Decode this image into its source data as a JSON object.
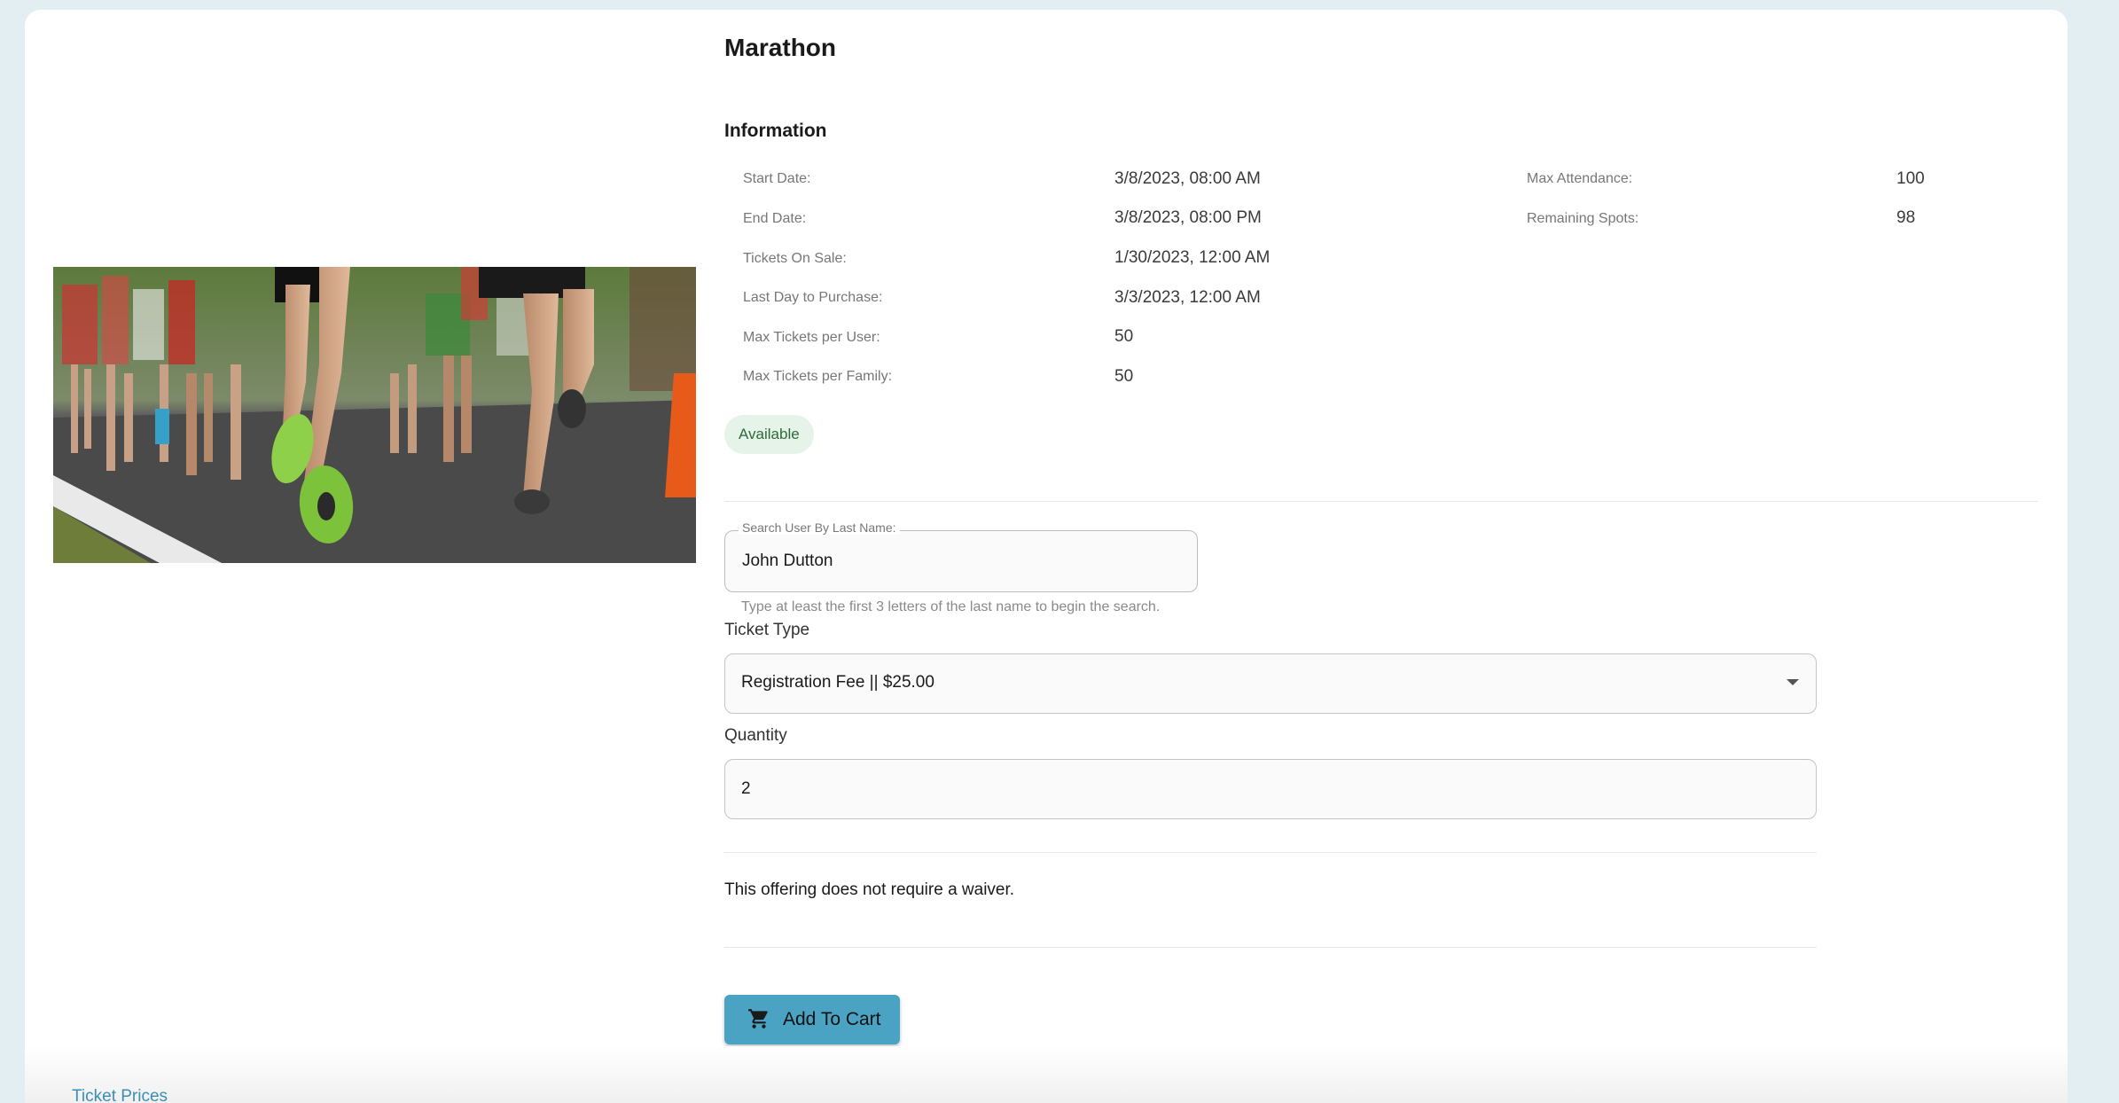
{
  "event": {
    "title": "Marathon",
    "section_title": "Information"
  },
  "info_left": [
    {
      "label": "Start Date:",
      "value": "3/8/2023, 08:00 AM"
    },
    {
      "label": "End Date:",
      "value": "3/8/2023, 08:00 PM"
    },
    {
      "label": "Tickets On Sale:",
      "value": "1/30/2023, 12:00 AM"
    },
    {
      "label": "Last Day to Purchase:",
      "value": "3/3/2023, 12:00 AM"
    },
    {
      "label": "Max Tickets per User:",
      "value": "50"
    },
    {
      "label": "Max Tickets per Family:",
      "value": "50"
    }
  ],
  "info_right": [
    {
      "label": "Max Attendance:",
      "value": "100"
    },
    {
      "label": "Remaining Spots:",
      "value": "98"
    }
  ],
  "status_chip": "Available",
  "search": {
    "label": "Search User By Last Name:",
    "value": "John Dutton",
    "helper": "Type at least the first 3 letters of the last name to begin the search."
  },
  "ticket_type": {
    "caption": "Ticket Type",
    "selected": "Registration Fee || $25.00"
  },
  "quantity": {
    "caption": "Quantity",
    "value": "2"
  },
  "waiver_text": "This offering does not require a waiver.",
  "cart_button": {
    "label": "Add To Cart",
    "icon": "shopping-cart-icon"
  },
  "footer_link": "Ticket Prices",
  "colors": {
    "accent": "#4aa3c3",
    "chip_bg": "#e6f3e9",
    "chip_text": "#2e6b3a",
    "link": "#3b8fb4"
  }
}
